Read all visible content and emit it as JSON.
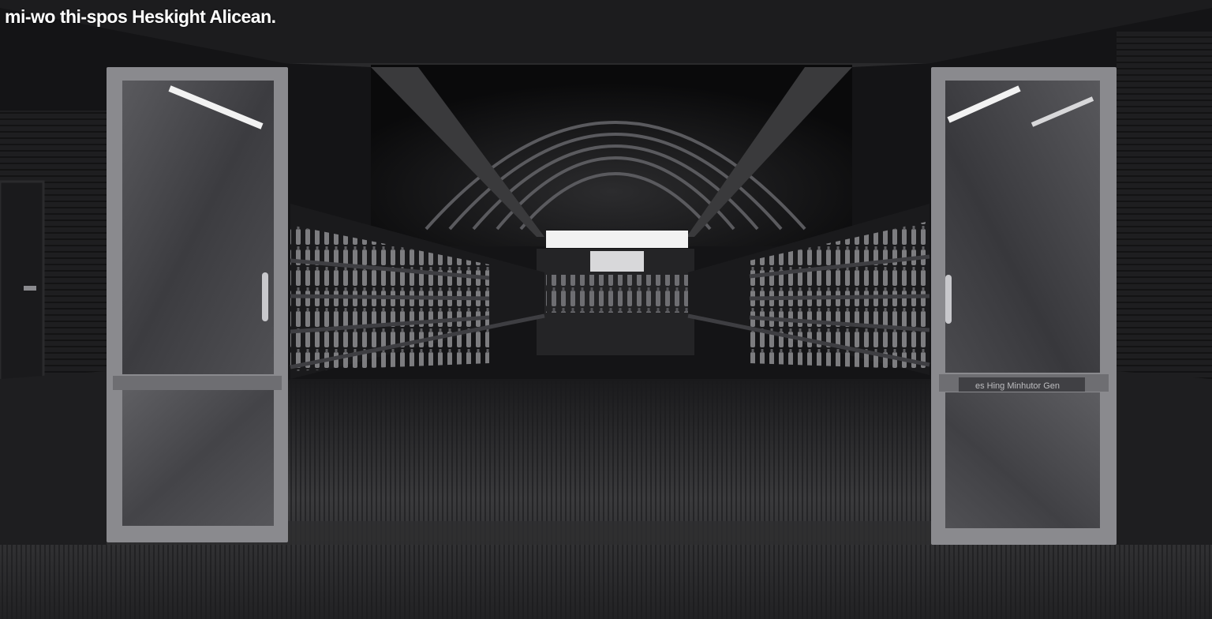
{
  "caption": "mi-wo thi-spos Heskight Alicean.",
  "door_plate_text": "es Hing Minhutor Gen",
  "colors": {
    "background": "#0d0d0e",
    "wall": "#1c1c1e",
    "floor": "#2a2a2c",
    "door_frame": "#8a8a8e",
    "glass": "#4a4a4e",
    "light": "#f2f2f2",
    "caption": "#ffffff"
  },
  "icons": [
    "door-handle-icon",
    "ceiling-light-icon"
  ]
}
